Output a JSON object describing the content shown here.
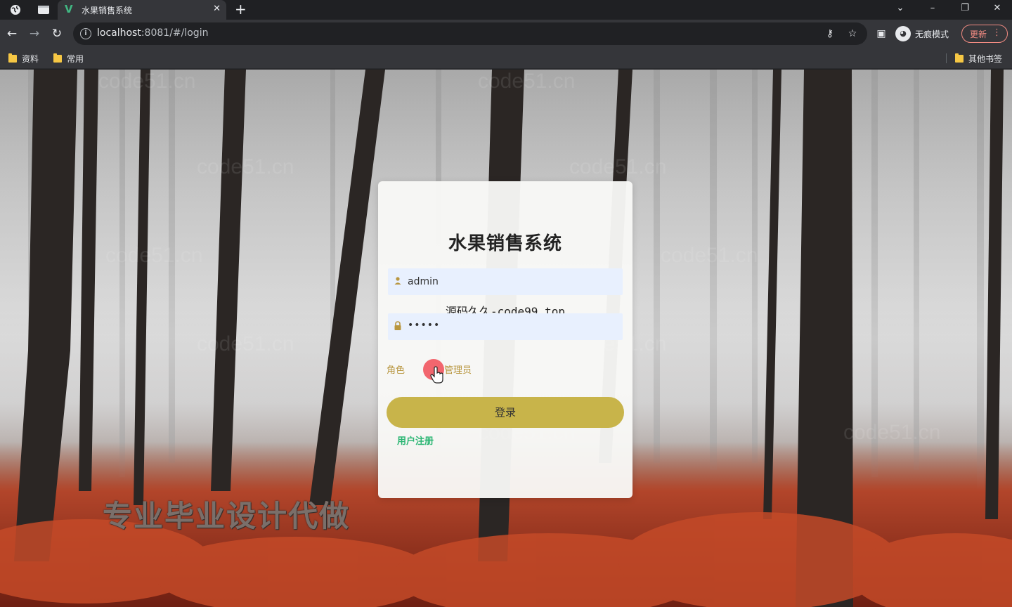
{
  "browser": {
    "tab_title": "水果销售系统",
    "tab_favicon": "vue-logo-icon",
    "new_tab_label": "+",
    "url_host": "localhost",
    "url_path": ":8081/#/login",
    "incognito_label": "无痕模式",
    "update_label": "更新",
    "bookmarks": [
      {
        "label": "资料"
      },
      {
        "label": "常用"
      }
    ],
    "other_bookmarks_label": "其他书签"
  },
  "page": {
    "background_watermarks": [
      "code51.cn"
    ],
    "ad_text": "专业毕业设计代做"
  },
  "login": {
    "title": "水果销售系统",
    "username_value": "admin",
    "password_value": "•••••",
    "overlay_text": "源码久久-code99.top",
    "role_label": "角色",
    "role_option": "管理员",
    "login_button": "登录",
    "register_link": "用户注册"
  },
  "colors": {
    "accent_button": "#c8b44a",
    "register_link": "#2bb673",
    "role_text": "#b8963f",
    "input_bg": "#e8f0fe"
  }
}
